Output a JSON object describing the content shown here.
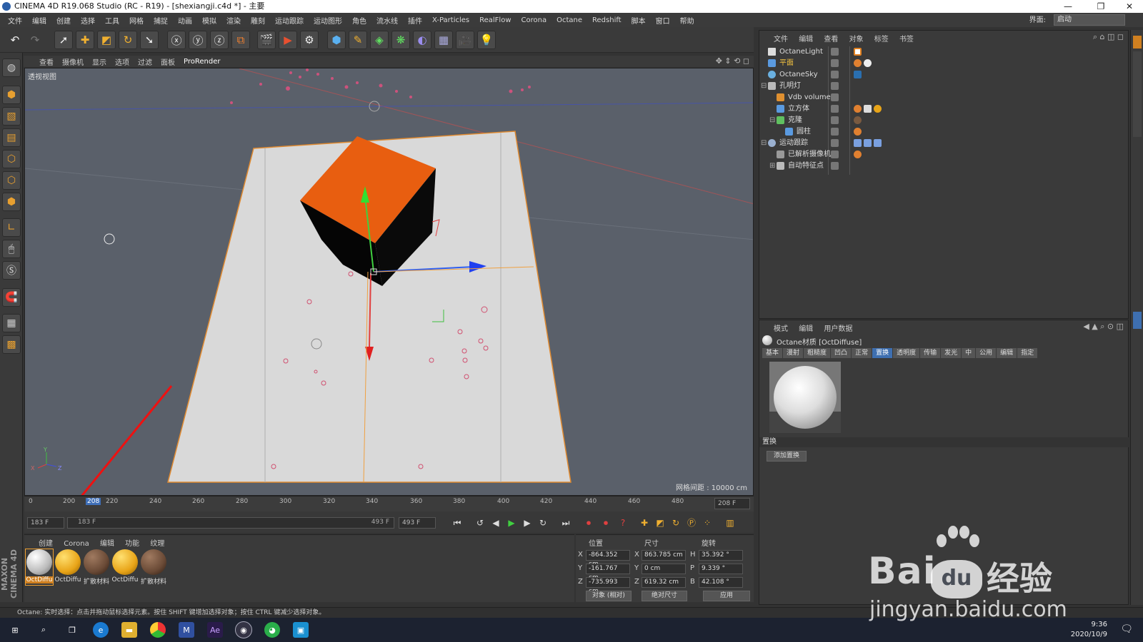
{
  "window": {
    "title": "CINEMA 4D R19.068 Studio (RC - R19) - [shexiangji.c4d *] - 主要"
  },
  "menu": [
    "文件",
    "编辑",
    "创建",
    "选择",
    "工具",
    "网格",
    "捕捉",
    "动画",
    "模拟",
    "渲染",
    "雕刻",
    "运动跟踪",
    "运动图形",
    "角色",
    "流水线",
    "插件",
    "X-Particles",
    "RealFlow",
    "Corona",
    "Octane",
    "Redshift",
    "脚本",
    "窗口",
    "帮助"
  ],
  "layout": {
    "label": "界面:",
    "value": "启动"
  },
  "viewport": {
    "menu": [
      "查看",
      "摄像机",
      "显示",
      "选项",
      "过滤",
      "面板"
    ],
    "menu_extra": "ProRender",
    "label": "透视视图",
    "grid_info": "网格间距 : 10000 cm",
    "axis": {
      "x": "X",
      "y": "Y",
      "z": "Z"
    }
  },
  "timeline": {
    "ticks": [
      "0",
      "200",
      "208",
      "220",
      "240",
      "260",
      "280",
      "300",
      "320",
      "340",
      "360",
      "380",
      "400",
      "420",
      "440",
      "460",
      "480"
    ],
    "current": "208",
    "end_frame": "208 F"
  },
  "playbar": {
    "start": "183 F",
    "range_start": "183 F",
    "range_end": "493 F",
    "end": "493 F"
  },
  "materials": {
    "tabs": [
      "创建",
      "Corona",
      "编辑",
      "功能",
      "纹理"
    ],
    "items": [
      {
        "label": "OctDiffu",
        "color": "#e8e8e8"
      },
      {
        "label": "OctDiffu",
        "color": "#e8a418"
      },
      {
        "label": "扩散材料",
        "color": "#6a4a36"
      },
      {
        "label": "OctDiffu",
        "color": "#e8a418"
      },
      {
        "label": "扩散材料",
        "color": "#6a4a36"
      }
    ]
  },
  "brand": "MAXON CINEMA 4D",
  "coords": {
    "headers": [
      "位置",
      "尺寸",
      "旋转"
    ],
    "rows": [
      {
        "axis": "X",
        "pos": "-864.352 cm",
        "size_axis": "X",
        "size": "863.785 cm",
        "rot_axis": "H",
        "rot": "35.392 °"
      },
      {
        "axis": "Y",
        "pos": "-161.767 cm",
        "size_axis": "Y",
        "size": "0 cm",
        "rot_axis": "P",
        "rot": "9.339 °"
      },
      {
        "axis": "Z",
        "pos": "-735.993 cm",
        "size_axis": "Z",
        "size": "619.32 cm",
        "rot_axis": "B",
        "rot": "42.108 °"
      }
    ],
    "mode": "对象 (相对)",
    "size_mode": "绝对尺寸",
    "apply": "应用"
  },
  "objects": {
    "menu": [
      "文件",
      "编辑",
      "查看",
      "对象",
      "标签",
      "书签"
    ],
    "items": [
      {
        "name": "OctaneLight",
        "indent": 0,
        "color": "#ddd"
      },
      {
        "name": "平面",
        "indent": 0,
        "color": "#f0c040"
      },
      {
        "name": "OctaneSky",
        "indent": 0,
        "color": "#ddd"
      },
      {
        "name": "孔明灯",
        "indent": 0,
        "color": "#ddd"
      },
      {
        "name": "Vdb volume",
        "indent": 1,
        "color": "#ddd"
      },
      {
        "name": "立方体",
        "indent": 1,
        "color": "#ddd"
      },
      {
        "name": "克隆",
        "indent": 1,
        "color": "#ddd"
      },
      {
        "name": "圆柱",
        "indent": 2,
        "color": "#ddd"
      },
      {
        "name": "运动跟踪",
        "indent": 0,
        "color": "#ddd"
      },
      {
        "name": "已解析摄像机",
        "indent": 1,
        "color": "#ddd"
      },
      {
        "name": "自动特征点",
        "indent": 1,
        "color": "#ddd"
      }
    ]
  },
  "attributes": {
    "menu": [
      "模式",
      "编辑",
      "用户数据"
    ],
    "title": "Octane材质 [OctDiffuse]",
    "tabs": [
      "基本",
      "漫射",
      "粗糙度",
      "凹凸",
      "正常",
      "置换",
      "透明度",
      "传输",
      "发光",
      "中",
      "公用",
      "编辑",
      "指定"
    ],
    "active_tab": "置换",
    "section": "置换",
    "add_button": "添加置换"
  },
  "status": "Octane:    实时选择：点击并拖动鼠标选择元素。按住 SHIFT 键增加选择对象；按住 CTRL 键减少选择对象。",
  "taskbar": {
    "time": "9:36",
    "date": "2020/10/9"
  },
  "watermark": {
    "brand": "Bai",
    "paw": "du",
    "suffix": "经验",
    "url": "jingyan.baidu.com"
  }
}
